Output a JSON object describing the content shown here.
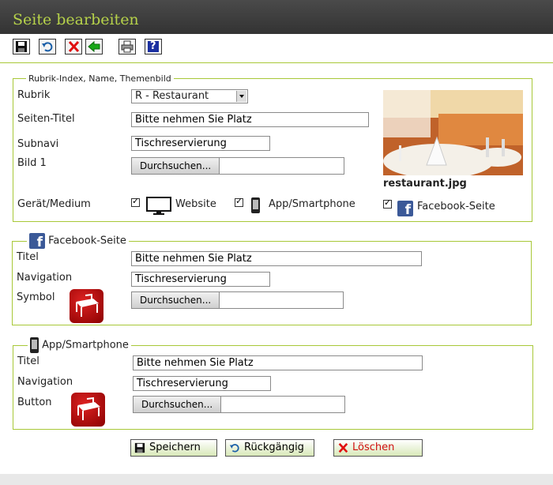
{
  "window": {
    "title": "Seite bearbeiten"
  },
  "toolbar": {
    "icons": [
      "save-icon",
      "undo-icon",
      "delete-icon",
      "back-arrow-icon",
      "print-icon",
      "help-icon"
    ],
    "help_label": "?"
  },
  "section_main": {
    "legend": "Rubrik-Index, Name, Themenbild",
    "rubrik_label": "Rubrik",
    "rubrik_value": "R - Restaurant",
    "titel_label": "Seiten-Titel",
    "titel_value": "Bitte nehmen Sie Platz",
    "subnavi_label": "Subnavi",
    "subnavi_value": "Tischreservierung",
    "bild_label": "Bild 1",
    "browse_label": "Durchsuchen...",
    "image_caption": "restaurant.jpg",
    "device_label": "Gerät/Medium",
    "devices": [
      {
        "label": "Website",
        "checked": true,
        "icon": "monitor-icon"
      },
      {
        "label": "App/Smartphone",
        "checked": true,
        "icon": "smartphone-icon"
      },
      {
        "label": "Facebook-Seite",
        "checked": true,
        "icon": "facebook-icon"
      }
    ]
  },
  "section_facebook": {
    "legend": "Facebook-Seite",
    "titel_label": "Titel",
    "titel_value": "Bitte nehmen Sie Platz",
    "nav_label": "Navigation",
    "nav_value": "Tischreservierung",
    "symbol_label": "Symbol",
    "browse_label": "Durchsuchen...",
    "symbol_icon": "table-chairs-icon"
  },
  "section_app": {
    "legend": "App/Smartphone",
    "titel_label": "Titel",
    "titel_value": "Bitte nehmen Sie Platz",
    "nav_label": "Navigation",
    "nav_value": "Tischreservierung",
    "button_label": "Button",
    "browse_label": "Durchsuchen...",
    "button_icon": "table-chairs-icon"
  },
  "actions": {
    "save": "Speichern",
    "undo": "Rückgängig",
    "delete": "Löschen"
  },
  "colors": {
    "accent": "#a8c838",
    "title_text": "#b6d24a",
    "titlebar": "#3a3a3a",
    "symbol_red": "#b00000",
    "facebook": "#3b5998"
  }
}
